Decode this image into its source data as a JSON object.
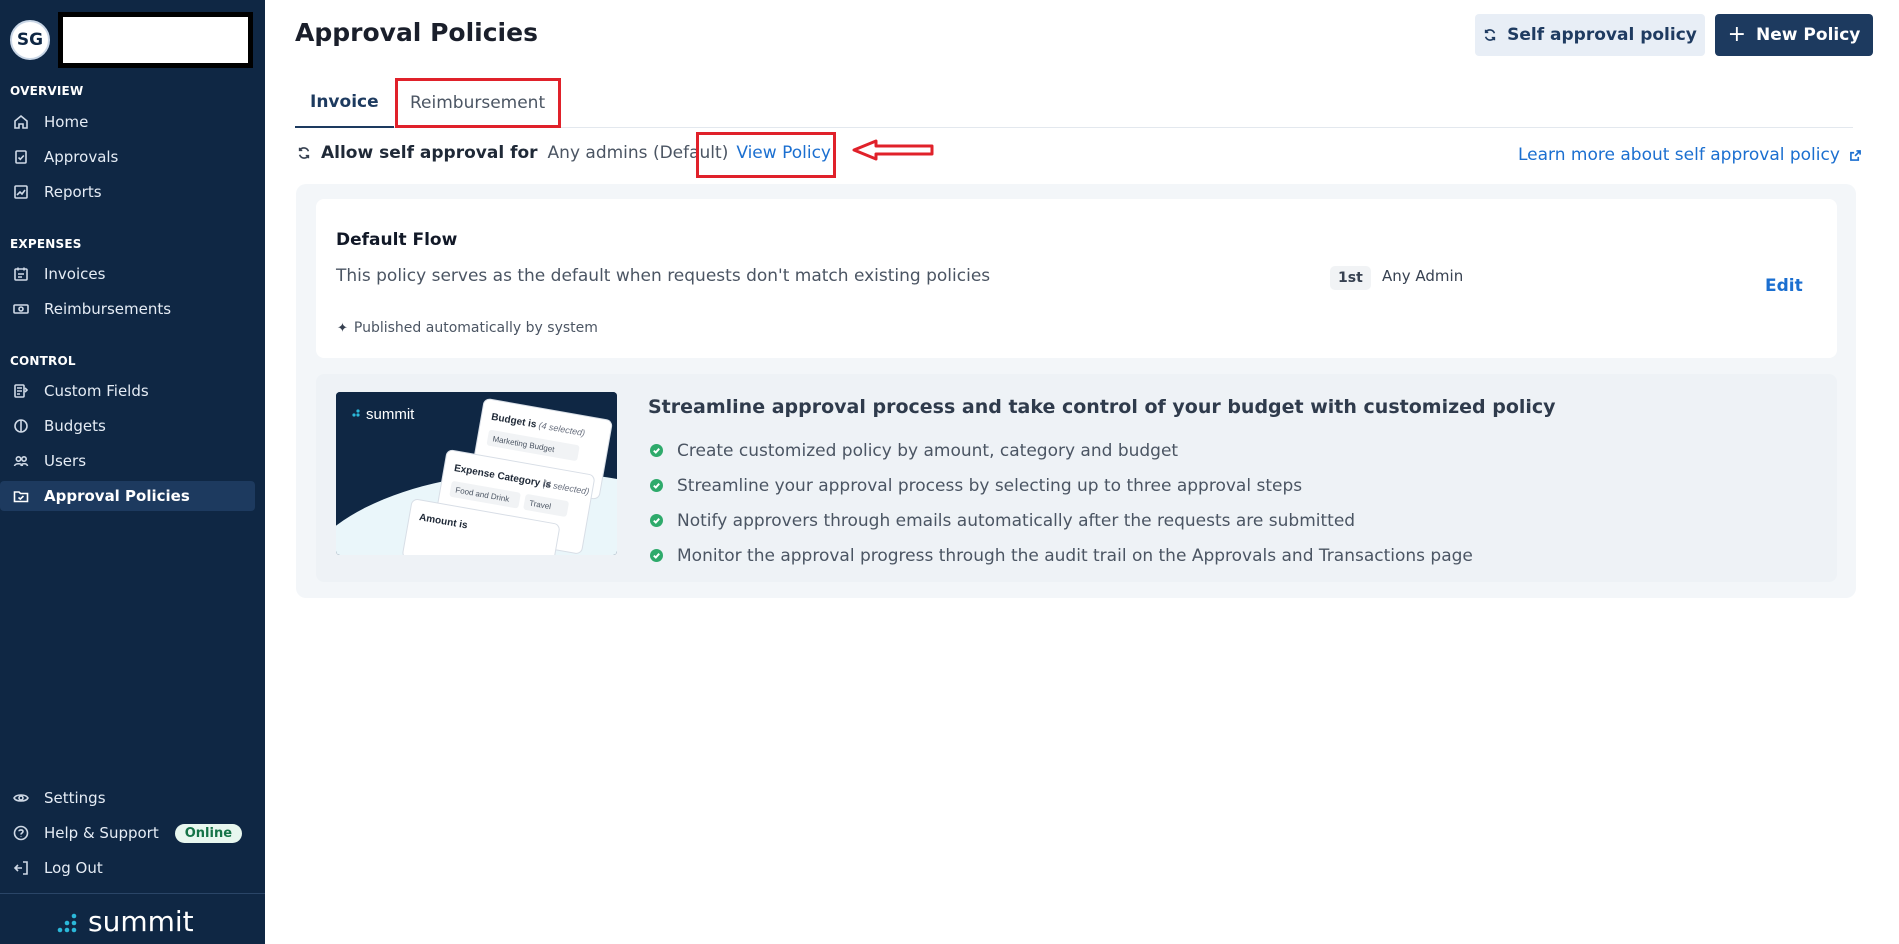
{
  "sidebar": {
    "avatar_initials": "SG",
    "sections": {
      "overview": "OVERVIEW",
      "expenses": "EXPENSES",
      "control": "CONTROL"
    },
    "items": {
      "home": "Home",
      "approvals": "Approvals",
      "reports": "Reports",
      "invoices": "Invoices",
      "reimbursements": "Reimbursements",
      "custom_fields": "Custom Fields",
      "budgets": "Budgets",
      "users": "Users",
      "approval_policies": "Approval Policies",
      "settings": "Settings",
      "help": "Help & Support",
      "logout": "Log Out"
    },
    "online_badge": "Online",
    "logo_text": "summit"
  },
  "header": {
    "title": "Approval Policies",
    "self_approval_button": "Self approval policy",
    "new_policy_button": "New Policy"
  },
  "tabs": {
    "invoice": "Invoice",
    "reimbursement": "Reimbursement"
  },
  "self_approval": {
    "label": "Allow self approval for",
    "value": "Any admins (Default)",
    "view_link": "View Policy",
    "learn_more": "Learn more about self approval policy"
  },
  "default_flow": {
    "title": "Default Flow",
    "description": "This policy serves as the default when requests don't match existing policies",
    "step": "1st",
    "approver": "Any Admin",
    "edit": "Edit",
    "published": "Published automatically by system"
  },
  "promo": {
    "image_logo": "summit",
    "image_labels": {
      "budget": "Budget is",
      "budget_selected": "(4 selected)",
      "marketing": "Marketing Budget",
      "expense": "Expense Category is",
      "expense_selected": "(4 selected)",
      "food": "Food and Drink",
      "travel": "Travel",
      "amount": "Amount is"
    },
    "title": "Streamline approval process and take control of your budget with customized policy",
    "points": [
      "Create customized policy by amount, category and budget",
      "Streamline your approval process by selecting up to three approval steps",
      "Notify approvers through emails automatically after the requests are submitted",
      "Monitor the approval progress through the audit trail on the Approvals and Transactions page"
    ]
  },
  "colors": {
    "sidebar_bg": "#0f2744",
    "primary": "#1d3a5f",
    "link": "#1b6fd0",
    "annotation_red": "#e0212a",
    "check_green": "#2eaa6b"
  }
}
